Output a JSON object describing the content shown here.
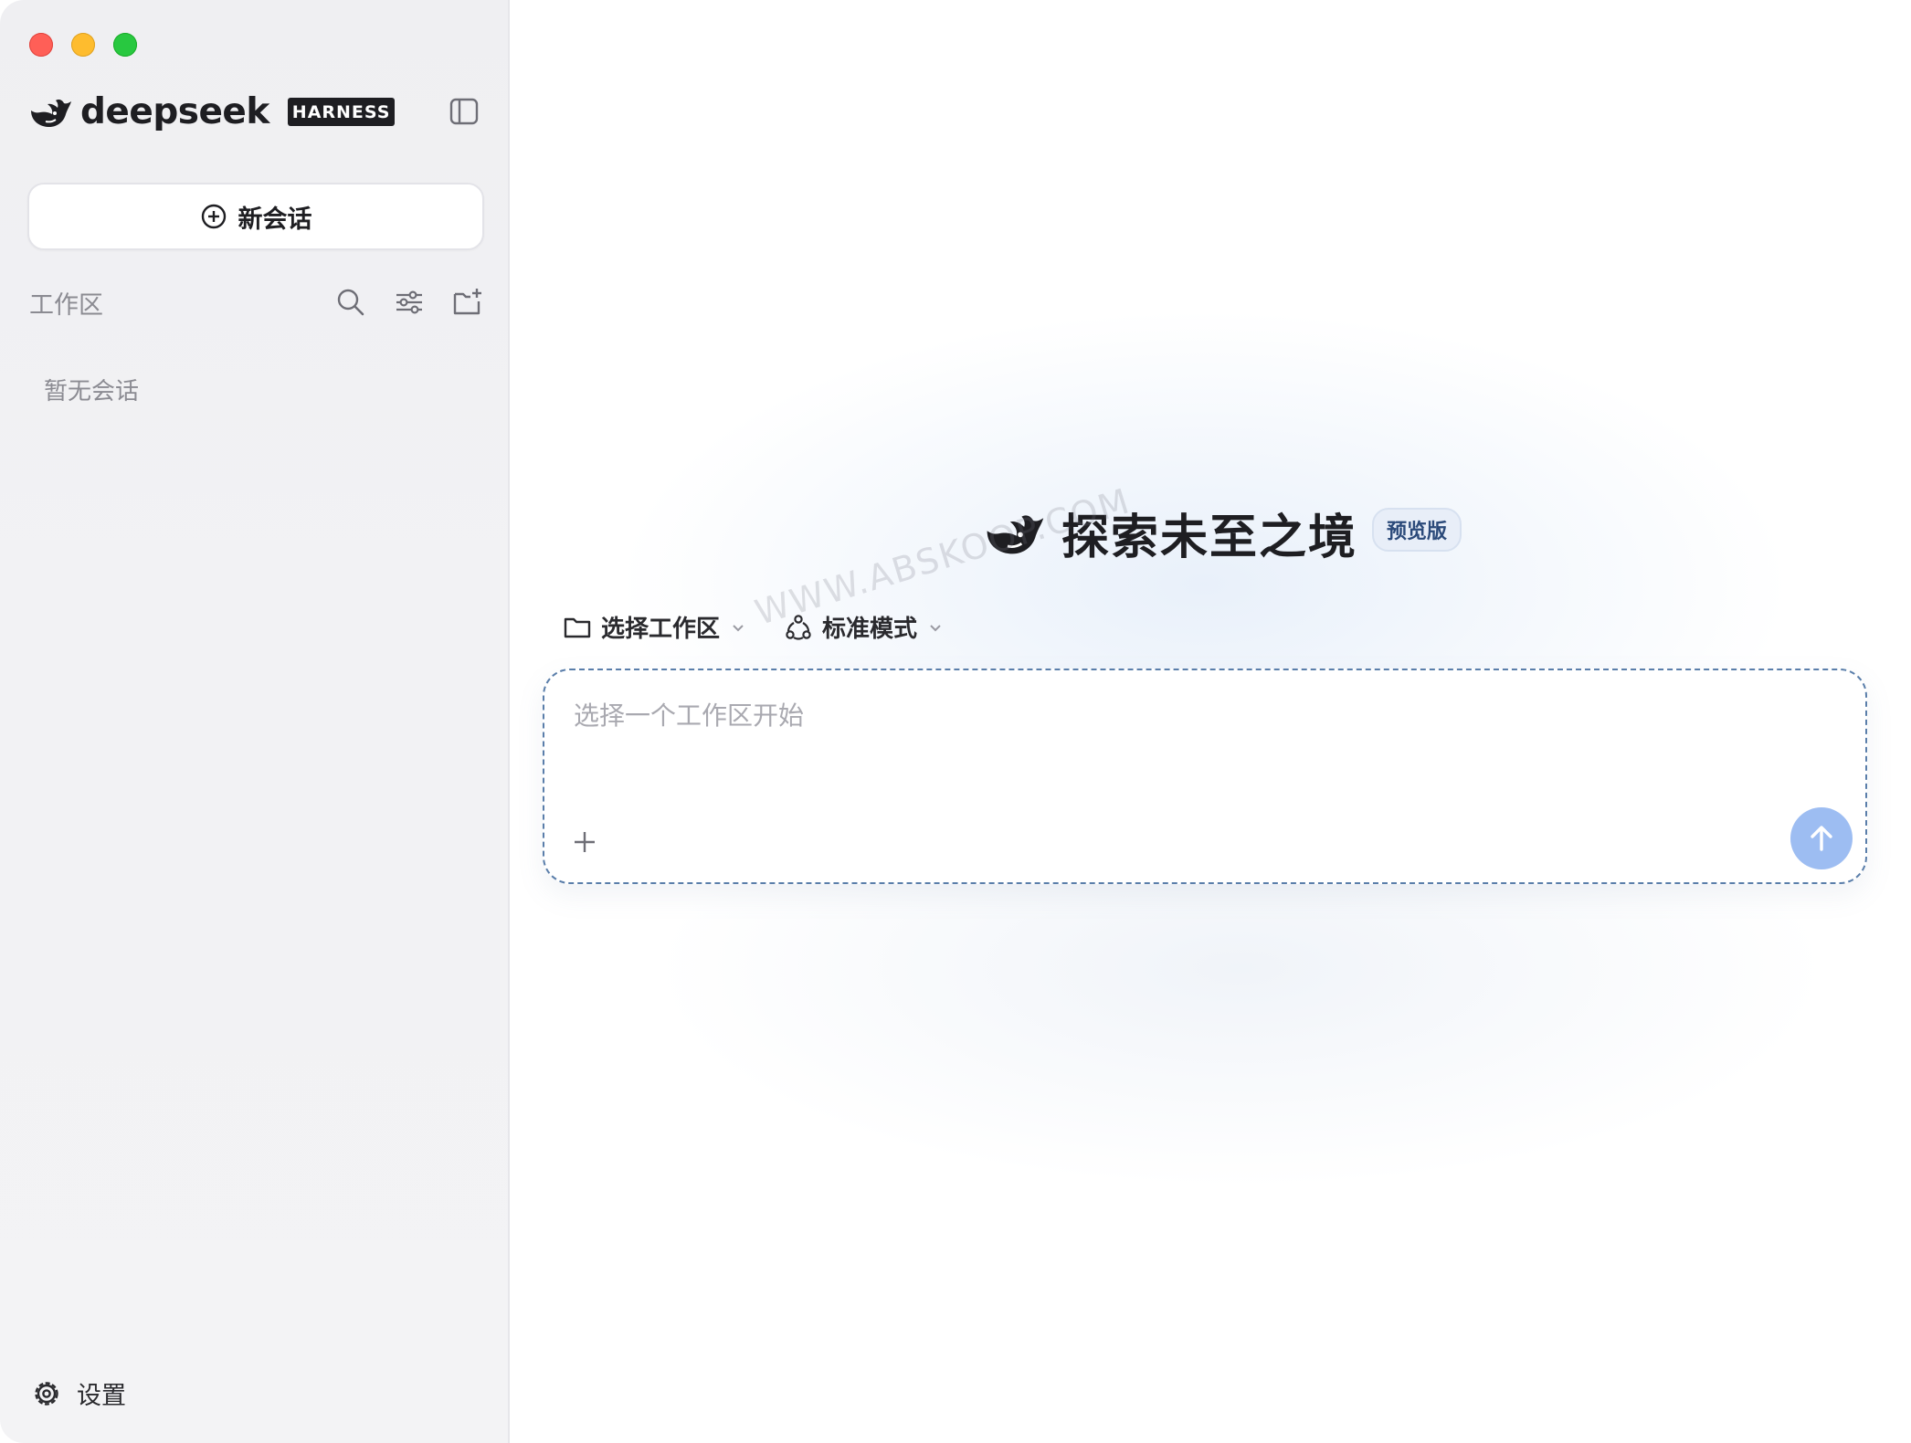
{
  "window": {
    "traffic_lights": {
      "close": "#ff5f57",
      "minimize": "#febc2e",
      "maximize": "#28c840"
    }
  },
  "sidebar": {
    "brand": {
      "name": "deepseek",
      "badge": "HARNESS",
      "logo_icon": "deepseek-whale-icon"
    },
    "toggle_icon": "sidebar-toggle-icon",
    "new_chat": {
      "label": "新会话",
      "icon": "plus-circle-icon"
    },
    "workspace": {
      "label": "工作区",
      "actions": [
        "search-icon",
        "filter-sliders-icon",
        "new-folder-icon"
      ]
    },
    "empty_state": "暂无会话",
    "settings": {
      "label": "设置",
      "icon": "gear-icon"
    }
  },
  "main": {
    "hero": {
      "title": "探索未至之境",
      "badge": "预览版",
      "logo_icon": "deepseek-whale-icon"
    },
    "workspace_selector": {
      "label": "选择工作区",
      "icon": "folder-icon"
    },
    "mode_selector": {
      "label": "标准模式",
      "icon": "mode-icon"
    },
    "input": {
      "placeholder": "选择一个工作区开始",
      "value": ""
    },
    "attach_icon": "plus-icon",
    "send_icon": "arrow-up-icon",
    "accent_color": "#9dbdf2"
  },
  "watermark": "WWW.ABSKOOP.COM"
}
